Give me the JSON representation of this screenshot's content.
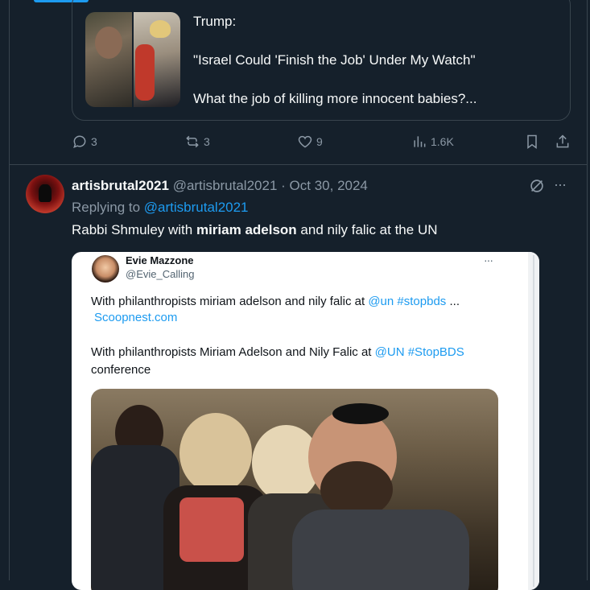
{
  "quoted_post": {
    "lines": [
      "Trump:",
      "\"Israel Could 'Finish the Job' Under My Watch\"",
      "What the job of killing more innocent babies?..."
    ]
  },
  "actions": {
    "replies": "3",
    "reposts": "3",
    "likes": "9",
    "views": "1.6K"
  },
  "reply": {
    "display_name": "artisbrutal2021",
    "handle": "@artisbrutal2021",
    "separator": "·",
    "date": "Oct 30, 2024",
    "replying_prefix": "Replying to",
    "replying_to": "@artisbrutal2021",
    "text_before": "Rabbi Shmuley with ",
    "text_bold": "miriam adelson",
    "text_after": " and nily falic at the UN"
  },
  "embedded_screenshot": {
    "name": "Evie Mazzone",
    "handle": "@Evie_Calling",
    "more": "···",
    "line1_text": "With philanthropists miriam adelson and nily falic at ",
    "line1_mention": "@un",
    "line1_space": " ",
    "line1_hashtag": "#stopbds",
    "line1_ellipsis": " ...",
    "line2_link": "Scoopnest.com",
    "line3_text": "With philanthropists Miriam Adelson and Nily Falic at ",
    "line3_mention": "@UN",
    "line3_space": " ",
    "line3_hashtag": "#StopBDS",
    "line4_text": "conference"
  },
  "icons": {
    "more": "···"
  },
  "colors": {
    "background": "#15202b",
    "border": "#38444d",
    "muted": "#8b98a5",
    "accent": "#1d9bf0",
    "text": "#f7f9f9"
  }
}
